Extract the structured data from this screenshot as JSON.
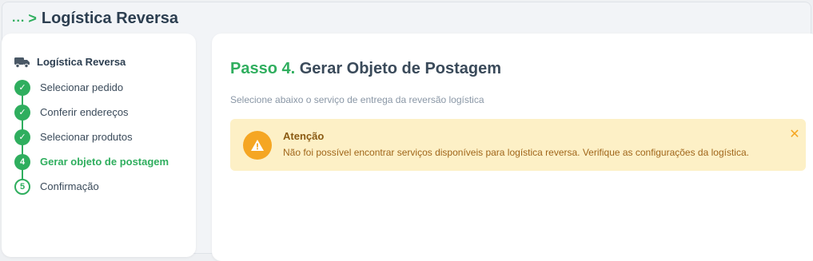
{
  "header": {
    "breadcrumb_ellipsis": "...",
    "breadcrumb_chevron": ">",
    "title": "Logística Reversa"
  },
  "sidebar": {
    "title": "Logística Reversa",
    "icon": "truck-icon",
    "steps": [
      {
        "label": "Selecionar pedido",
        "status": "done",
        "marker": "✓"
      },
      {
        "label": "Conferir endereços",
        "status": "done",
        "marker": "✓"
      },
      {
        "label": "Selecionar produtos",
        "status": "done",
        "marker": "✓"
      },
      {
        "label": "Gerar objeto de postagem",
        "status": "current",
        "marker": "4"
      },
      {
        "label": "Confirmação",
        "status": "pending",
        "marker": "5"
      }
    ]
  },
  "main": {
    "step_number": "Passo 4.",
    "step_title": "Gerar Objeto de Postagem",
    "description": "Selecione abaixo o serviço de entrega da reversão logística",
    "alert": {
      "title": "Atenção",
      "message": "Não foi possível encontrar serviços disponíveis para logística reversa. Verifique as configurações da logística.",
      "icon": "warning-icon",
      "close_icon": "close-icon"
    }
  },
  "colors": {
    "accent": "#2fae5e",
    "text_dark": "#2c3e50",
    "alert_bg": "#fdf0c6",
    "alert_icon": "#f5a623"
  }
}
